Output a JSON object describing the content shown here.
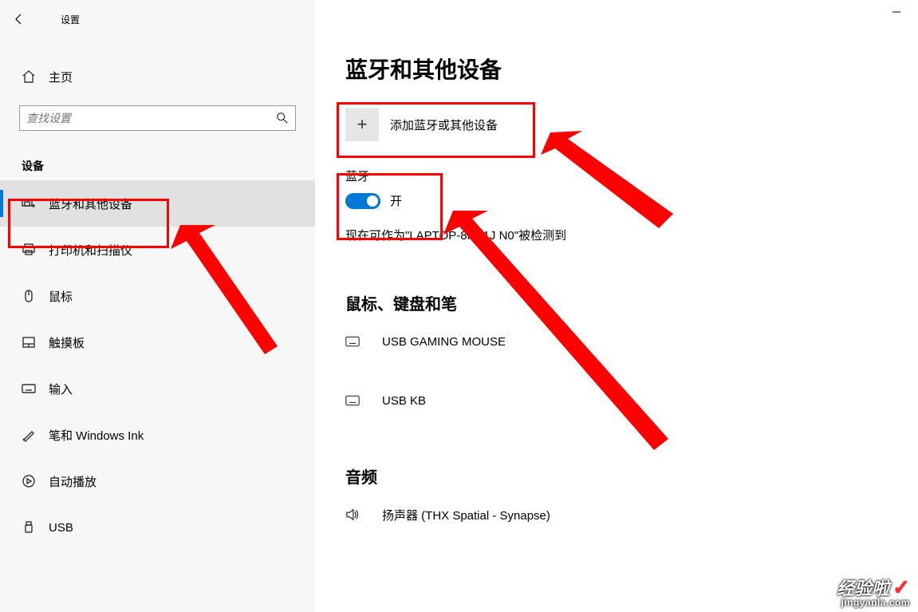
{
  "app_title": "设置",
  "home_label": "主页",
  "search_placeholder": "查找设置",
  "group_header": "设备",
  "nav": [
    {
      "label": "蓝牙和其他设备"
    },
    {
      "label": "打印机和扫描仪"
    },
    {
      "label": "鼠标"
    },
    {
      "label": "触摸板"
    },
    {
      "label": "输入"
    },
    {
      "label": "笔和 Windows Ink"
    },
    {
      "label": "自动播放"
    },
    {
      "label": "USB"
    }
  ],
  "main": {
    "page_title": "蓝牙和其他设备",
    "add_label": "添加蓝牙或其他设备",
    "bt_section": "蓝牙",
    "toggle_state": "开",
    "discoverable": "现在可作为\"LAPTOP-8PE1J   N0\"被检测到",
    "cat_mouse_kb": "鼠标、键盘和笔",
    "devices_mkb": [
      {
        "label": "USB GAMING MOUSE"
      },
      {
        "label": "USB KB"
      }
    ],
    "cat_audio": "音频",
    "devices_audio": [
      {
        "label": "扬声器 (THX Spatial - Synapse)"
      }
    ]
  },
  "watermark": {
    "brand": "经验啦",
    "url": "jingyanla.com"
  }
}
